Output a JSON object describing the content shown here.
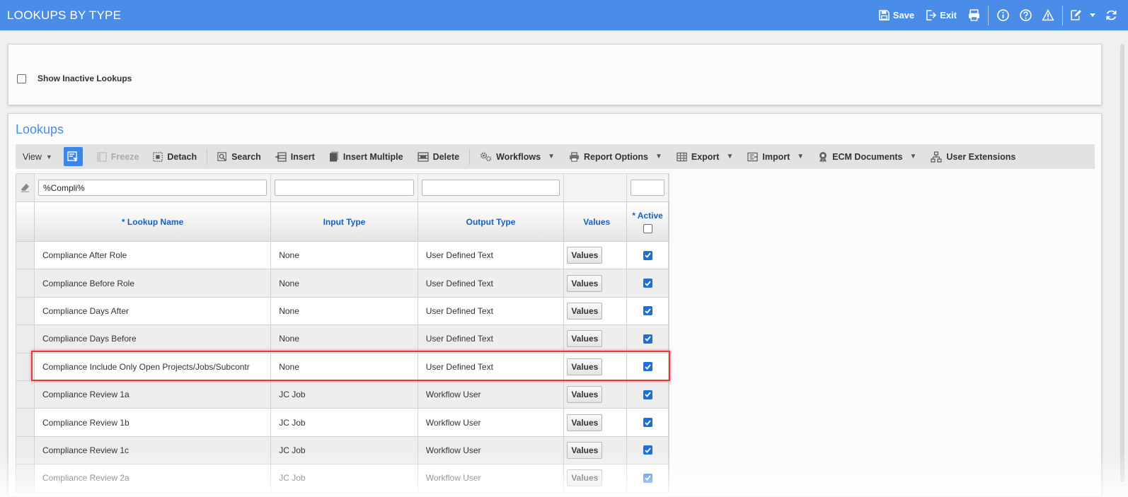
{
  "titlebar": {
    "title": "LOOKUPS BY TYPE",
    "save_label": "Save",
    "exit_label": "Exit",
    "accent": "#4a8de8"
  },
  "options_panel": {
    "show_inactive_label": "Show Inactive Lookups",
    "show_inactive_checked": false
  },
  "lookups": {
    "title": "Lookups",
    "toolbar": {
      "view": "View",
      "freeze": "Freeze",
      "detach": "Detach",
      "search": "Search",
      "insert": "Insert",
      "insert_multiple": "Insert Multiple",
      "delete": "Delete",
      "workflows": "Workflows",
      "report_options": "Report Options",
      "export": "Export",
      "import": "Import",
      "ecm_documents": "ECM Documents",
      "user_extensions": "User Extensions"
    },
    "filters": {
      "lookup_name": "%Compli%",
      "input_type": "",
      "output_type": "",
      "active": ""
    },
    "columns": {
      "lookup_name": "* Lookup Name",
      "input_type": "Input Type",
      "output_type": "Output Type",
      "values": "Values",
      "active": "* Active"
    },
    "rows": [
      {
        "name": "Compliance After Role",
        "input": "None",
        "output": "User Defined Text",
        "values": "Values",
        "active": true
      },
      {
        "name": "Compliance Before Role",
        "input": "None",
        "output": "User Defined Text",
        "values": "Values",
        "active": true
      },
      {
        "name": "Compliance Days After",
        "input": "None",
        "output": "User Defined Text",
        "values": "Values",
        "active": true
      },
      {
        "name": "Compliance Days Before",
        "input": "None",
        "output": "User Defined Text",
        "values": "Values",
        "active": true
      },
      {
        "name": "Compliance Include Only Open Projects/Jobs/Subcontr",
        "input": "None",
        "output": "User Defined Text",
        "values": "Values",
        "active": true
      },
      {
        "name": "Compliance Review 1a",
        "input": "JC Job",
        "output": "Workflow User",
        "values": "Values",
        "active": true
      },
      {
        "name": "Compliance Review 1b",
        "input": "JC Job",
        "output": "Workflow User",
        "values": "Values",
        "active": true
      },
      {
        "name": "Compliance Review 1c",
        "input": "JC Job",
        "output": "Workflow User",
        "values": "Values",
        "active": true
      },
      {
        "name": "Compliance Review 2a",
        "input": "JC Job",
        "output": "Workflow User",
        "values": "Values",
        "active": true
      }
    ]
  }
}
